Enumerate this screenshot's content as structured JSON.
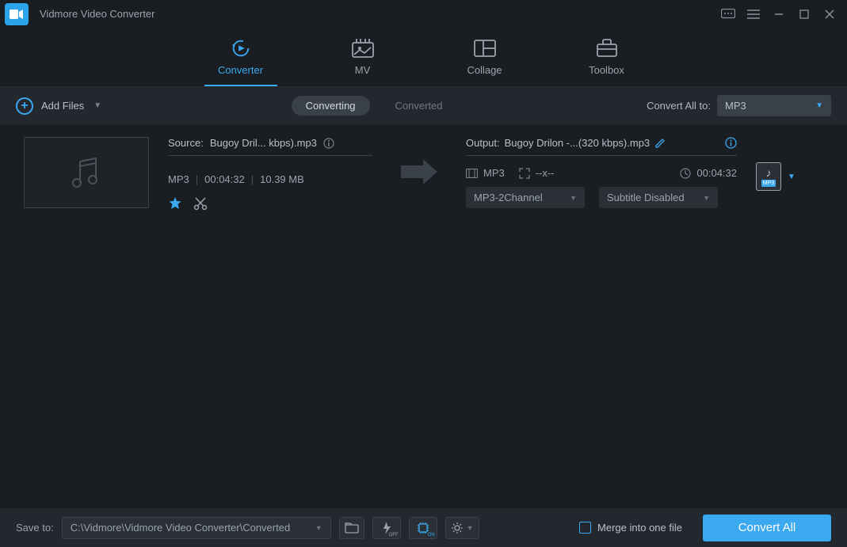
{
  "app": {
    "title": "Vidmore Video Converter"
  },
  "tabs": {
    "converter": "Converter",
    "mv": "MV",
    "collage": "Collage",
    "toolbox": "Toolbox"
  },
  "toolbar": {
    "add_files": "Add Files",
    "converting": "Converting",
    "converted": "Converted",
    "convert_all_to": "Convert All to:",
    "format": "MP3"
  },
  "file": {
    "source_label": "Source:",
    "source_name": "Bugoy Dril... kbps).mp3",
    "fmt": "MP3",
    "duration": "00:04:32",
    "size": "10.39 MB",
    "output_label": "Output:",
    "output_name": "Bugoy Drilon -...(320 kbps).mp3",
    "out_fmt": "MP3",
    "out_res": "--x--",
    "out_dur": "00:04:32",
    "audio_sel": "MP3-2Channel",
    "subtitle_sel": "Subtitle Disabled",
    "badge_fmt": "MP3"
  },
  "bottom": {
    "save_to": "Save to:",
    "path": "C:\\Vidmore\\Vidmore Video Converter\\Converted",
    "merge": "Merge into one file",
    "convert_all": "Convert All",
    "accel_off": "OFF",
    "accel_on": "ON"
  }
}
